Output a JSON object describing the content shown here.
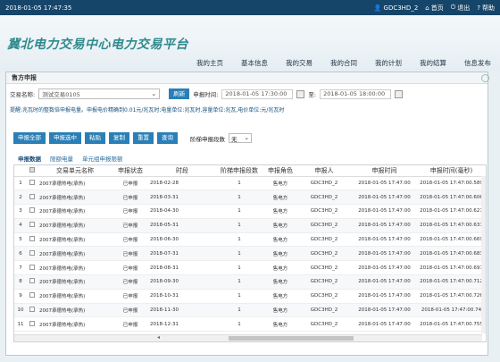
{
  "topbar": {
    "datetime": "2018-01-05 17:47:35",
    "user": "GDC3HD_2",
    "home": "首页",
    "logout": "退出",
    "help": "帮助"
  },
  "header": {
    "logo": "冀北电力交易中心电力交易平台",
    "nav": [
      "我的主页",
      "基本信息",
      "我的交易",
      "我的合同",
      "我的计划",
      "我的结算",
      "信息发布"
    ]
  },
  "dialog": {
    "title": "售方申报",
    "trade_name_label": "交易名称:",
    "trade_name_value": "测试交易0105",
    "refresh_label": "刷新",
    "apply_time_label": "申报时间:",
    "apply_start": "2018-01-05 17:30:00",
    "to_label": "至:",
    "apply_end": "2018-01-05 18:00:00",
    "note": "提醒:兆瓦时的整数倍申报电量。申报电价精确到0.01元/兆瓦时;电量单位:兆瓦时,容量单位:兆瓦,电价单位:元/兆瓦时",
    "buttons": [
      "申报全部",
      "申报选中",
      "粘贴",
      "复制",
      "重置",
      "查询"
    ],
    "tier_label": "阶梯申报段数",
    "tier_value": "无"
  },
  "tabs": [
    "申报数据",
    "限额电量",
    "单元组申报限额"
  ],
  "table": {
    "headers": [
      "",
      "交易单元名称",
      "申报状态",
      "时段",
      "阶梯申报段数",
      "申报角色",
      "申报人",
      "申报时间",
      "申报时间(毫秒)"
    ],
    "rows": [
      [
        "1",
        "2007承德热电(承热)",
        "已申报",
        "2018-02-28",
        "1",
        "售电方",
        "GDC3HD_2",
        "2018-01-05 17:47:00",
        "2018-01-05 17:47:00.589"
      ],
      [
        "2",
        "2007承德热电(承热)",
        "已申报",
        "2018-03-31",
        "1",
        "售电方",
        "GDC3HD_2",
        "2018-01-05 17:47:00",
        "2018-01-05 17:47:00.606"
      ],
      [
        "3",
        "2007承德热电(承热)",
        "已申报",
        "2018-04-30",
        "1",
        "售电方",
        "GDC3HD_2",
        "2018-01-05 17:47:00",
        "2018-01-05 17:47:00.621"
      ],
      [
        "4",
        "2007承德热电(承热)",
        "已申报",
        "2018-05-31",
        "1",
        "售电方",
        "GDC3HD_2",
        "2018-01-05 17:47:00",
        "2018-01-05 17:47:00.637"
      ],
      [
        "5",
        "2007承德热电(承热)",
        "已申报",
        "2018-06-30",
        "1",
        "售电方",
        "GDC3HD_2",
        "2018-01-05 17:47:00",
        "2018-01-05 17:47:00.669"
      ],
      [
        "6",
        "2007承德热电(承热)",
        "已申报",
        "2018-07-31",
        "1",
        "售电方",
        "GDC3HD_2",
        "2018-01-05 17:47:00",
        "2018-01-05 17:47:00.683"
      ],
      [
        "7",
        "2007承德热电(承热)",
        "已申报",
        "2018-08-31",
        "1",
        "售电方",
        "GDC3HD_2",
        "2018-01-05 17:47:00",
        "2018-01-05 17:47:00.697"
      ],
      [
        "8",
        "2007承德热电(承热)",
        "已申报",
        "2018-09-30",
        "1",
        "售电方",
        "GDC3HD_2",
        "2018-01-05 17:47:00",
        "2018-01-05 17:47:00.712"
      ],
      [
        "9",
        "2007承德热电(承热)",
        "已申报",
        "2018-10-31",
        "1",
        "售电方",
        "GDC3HD_2",
        "2018-01-05 17:47:00",
        "2018-01-05 17:47:00.726"
      ],
      [
        "10",
        "2007承德热电(承热)",
        "已申报",
        "2018-11-30",
        "1",
        "售电方",
        "GDC3HD_2",
        "2018-01-05 17:47:00",
        "2018-01-05 17:47:00.74"
      ],
      [
        "11",
        "2007承德热电(承热)",
        "已申报",
        "2018-12-31",
        "1",
        "售电方",
        "GDC3HD_2",
        "2018-01-05 17:47:00",
        "2018-01-05 17:47:00.755"
      ]
    ]
  },
  "colors": {
    "topbar": "#16456a",
    "button": "#2a7fb6",
    "logo": "#2f8a8e"
  }
}
